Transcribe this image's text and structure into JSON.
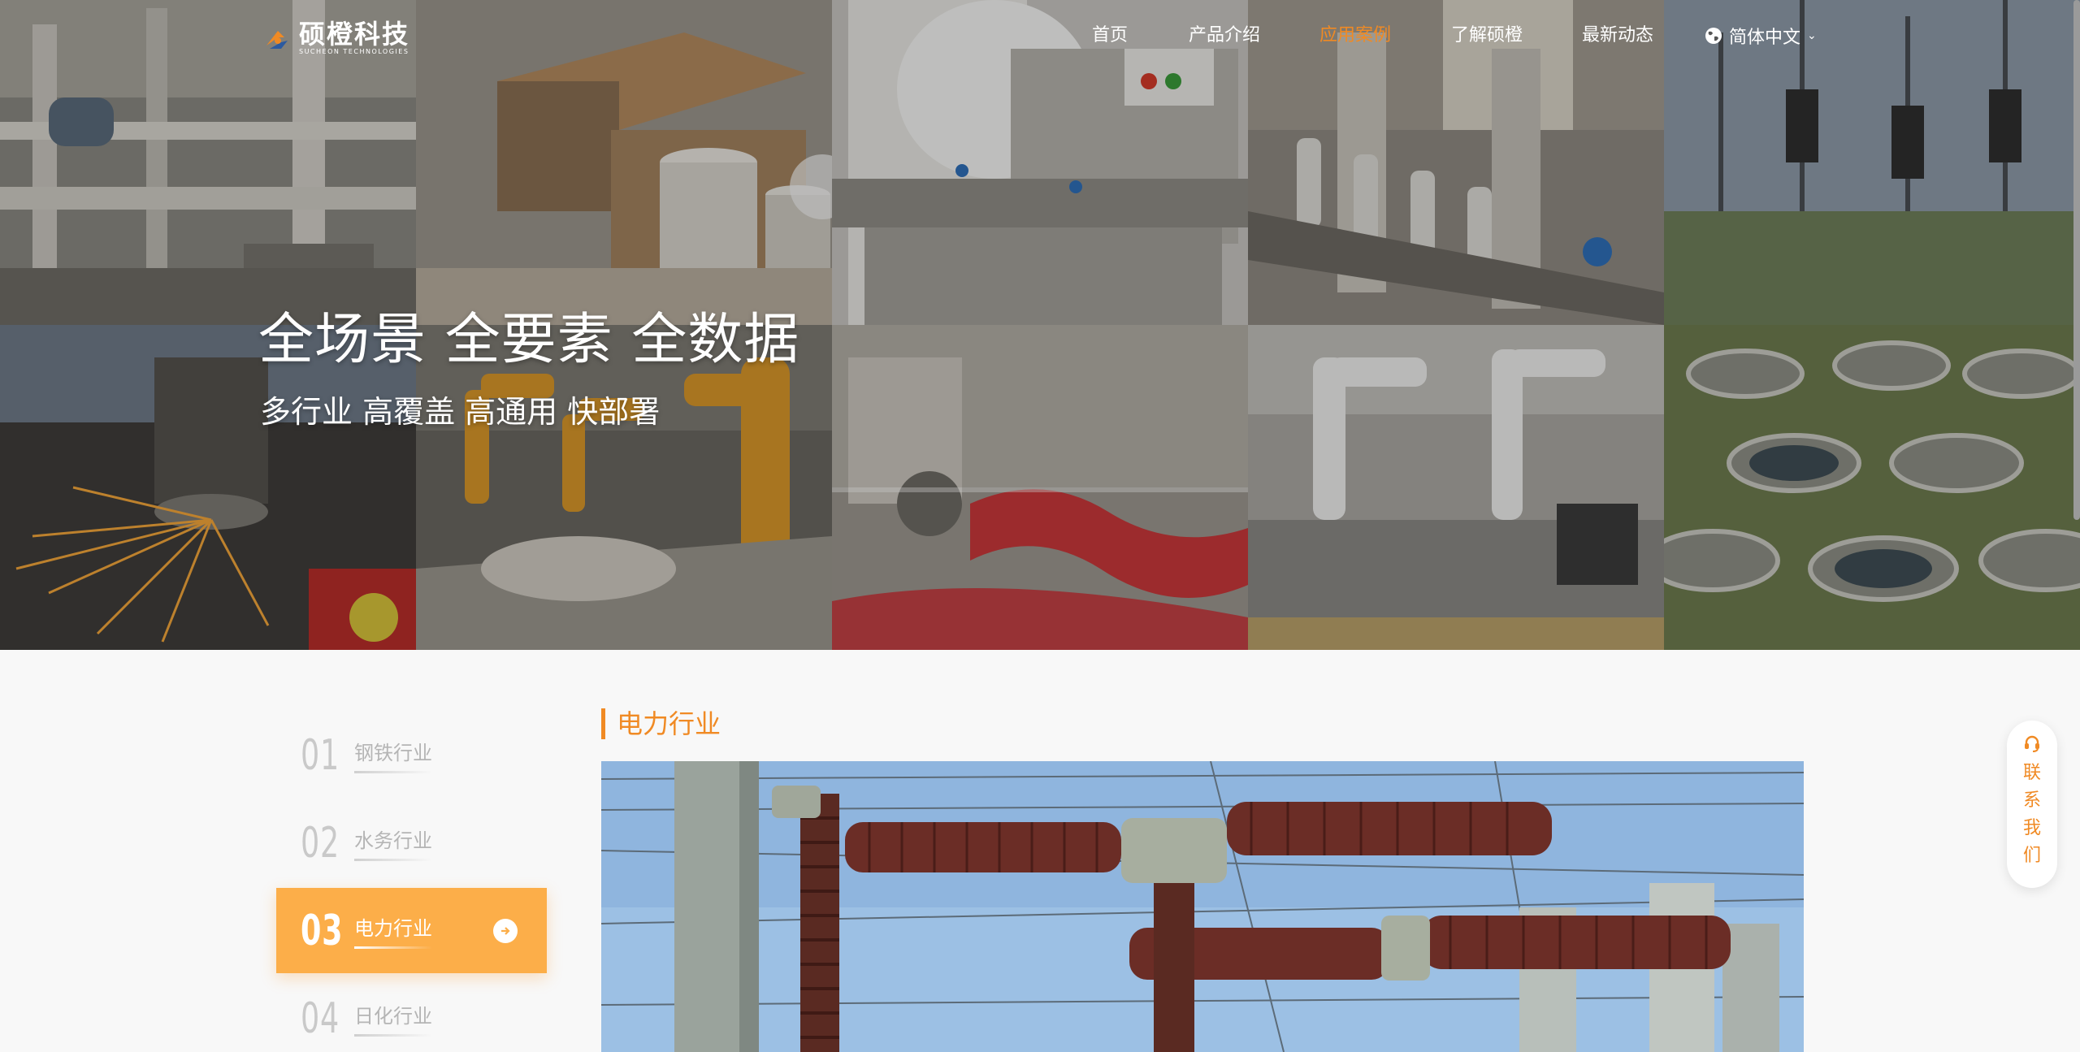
{
  "nav": {
    "logo_cn": "硕橙科技",
    "logo_en": "SUCHEON TECHNOLOGIES",
    "items": [
      {
        "label": "首页",
        "active": false
      },
      {
        "label": "产品介绍",
        "active": false
      },
      {
        "label": "应用案例",
        "active": true
      },
      {
        "label": "了解硕橙",
        "active": false
      },
      {
        "label": "最新动态",
        "active": false
      }
    ],
    "language": "简体中文"
  },
  "hero": {
    "title": "全场景 全要素 全数据",
    "subtitle": "多行业 高覆盖 高通用 快部署"
  },
  "industries": [
    {
      "num": "01",
      "label": "钢铁行业",
      "active": false
    },
    {
      "num": "02",
      "label": "水务行业",
      "active": false
    },
    {
      "num": "03",
      "label": "电力行业",
      "active": true
    },
    {
      "num": "04",
      "label": "日化行业",
      "active": false
    }
  ],
  "section": {
    "title": "电力行业"
  },
  "contact": {
    "chars": [
      "联",
      "系",
      "我",
      "们"
    ]
  },
  "colors": {
    "accent": "#f08a24",
    "active_tab": "#fcae49",
    "muted_num": "#c9c9c9"
  },
  "icons": {
    "language": "globe-icon",
    "language_caret": "chevron-down-icon",
    "active_arrow": "arrow-right-circle-icon",
    "contact": "headset-icon"
  }
}
